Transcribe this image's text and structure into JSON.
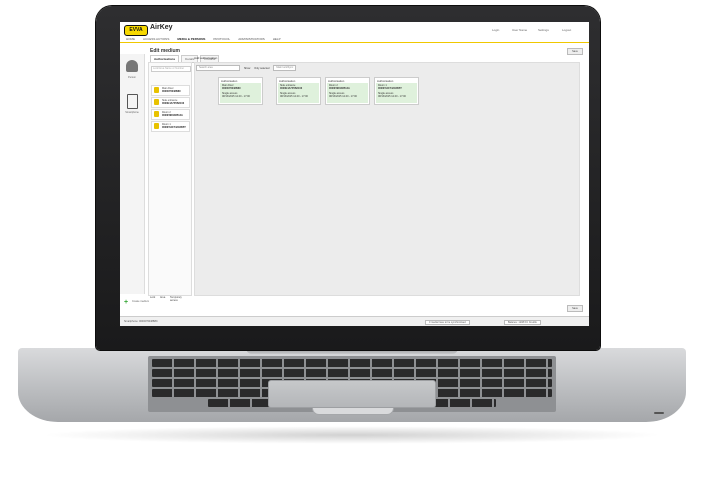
{
  "app": {
    "brand": "EVVA",
    "name": "AirKey",
    "header_right": [
      "Login",
      "User Name",
      "Settings",
      "Logout"
    ]
  },
  "nav": {
    "items": [
      "HOME",
      "ACCESS ACTIONS",
      "MEDIA & PERSONS",
      "PROTOCOL",
      "ADMINISTRATORS",
      "HELP"
    ],
    "active_index": 2
  },
  "page": {
    "title": "Edit medium",
    "tabs": [
      "Authorisations",
      "Details",
      "Protocol"
    ],
    "active_tab_index": 0,
    "add_authorisation": "Add authorisation",
    "search_placeholder": "Lock/Area Name or Number",
    "rail_labels": [
      "Person",
      "Smartphone"
    ]
  },
  "filters": {
    "search": "Search area",
    "show": "Show",
    "only_selected": "Only selected",
    "dropdown": "Main lock/Sync"
  },
  "left_list": [
    {
      "t1": "Main Door",
      "t2": "0000076048B8C"
    },
    {
      "t1": "Side entrance",
      "t2": "0000E4A7F5B2106"
    },
    {
      "t1": "Room 2",
      "t2": "0000F8D1D8514A"
    },
    {
      "t1": "Room 1",
      "t2": "0000F64C742A5B5T"
    }
  ],
  "cards": [
    {
      "header": "Authorisation",
      "lock": "Main Door",
      "id": "0000076048B8C",
      "type": "Single access",
      "date": "08/13/2015 12:40 - 17:00"
    },
    {
      "header": "Authorisation",
      "lock": "Side entrance",
      "id": "0000E4A7F5B2106",
      "type": "Single access",
      "date": "08/13/2015 12:40 - 17:00"
    },
    {
      "header": "Authorisation",
      "lock": "Room 2",
      "id": "0000F8D1D8514A",
      "type": "Single access",
      "date": "08/13/2015 12:40 - 17:00"
    },
    {
      "header": "Authorisation",
      "lock": "Room 1",
      "id": "0000F64C742A5B5T",
      "type": "Single access",
      "date": "08/13/2015 12:40 - 17:00"
    }
  ],
  "buttons": {
    "save": "Save",
    "new": "Create medium"
  },
  "bottom_tabs": [
    "Lock",
    "Area",
    "Temporary access"
  ],
  "status": {
    "left": "Smartphone: 0000076048B8C",
    "mid": "0 media have to be synchronised",
    "right": "Balance: 1208 KC Credits"
  },
  "colors": {
    "accent": "#F6D800",
    "card_body": "#DFF1DC",
    "laptop": "#1A1A1B",
    "deck": "#C8C9CB"
  }
}
